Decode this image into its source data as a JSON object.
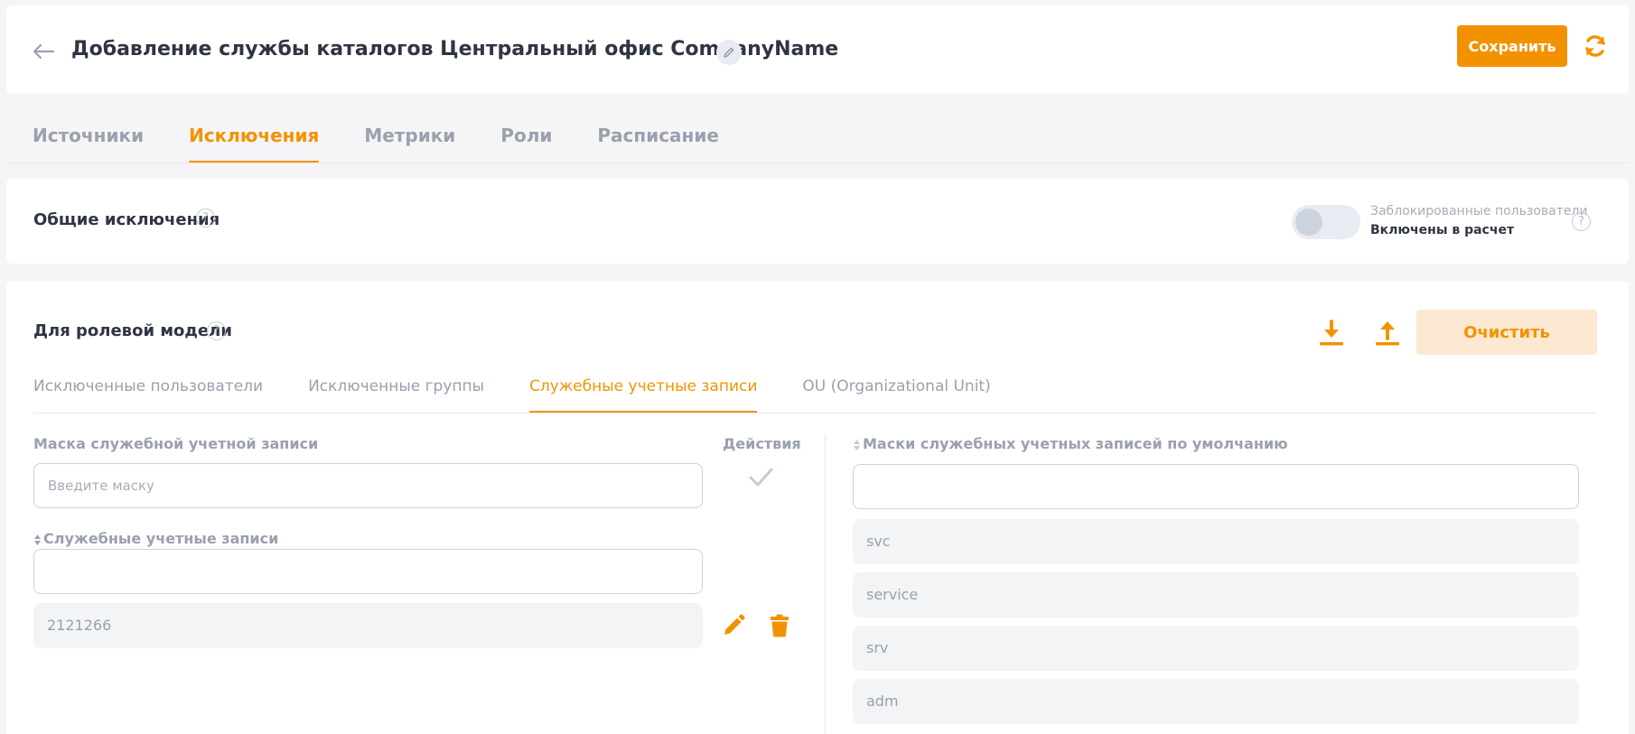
{
  "header": {
    "title": "Добавление службы каталогов Центральный офис CompanyName",
    "save_label": "Сохранить"
  },
  "main_tabs": [
    {
      "label": "Источники",
      "active": false
    },
    {
      "label": "Исключения",
      "active": true
    },
    {
      "label": "Метрики",
      "active": false
    },
    {
      "label": "Роли",
      "active": false
    },
    {
      "label": "Расписание",
      "active": false
    }
  ],
  "general": {
    "title": "Общие исключения",
    "toggle_enabled": false,
    "toggle_title": "Заблокированные пользователи",
    "toggle_status": "Включены в расчет"
  },
  "role_model": {
    "title": "Для ролевой модели",
    "clear_label": "Очистить",
    "tabs": [
      {
        "label": "Исключенные пользователи",
        "active": false
      },
      {
        "label": "Исключенные группы",
        "active": false
      },
      {
        "label": "Служебные учетные записи",
        "active": true
      },
      {
        "label": "OU (Organizational Unit)",
        "active": false
      }
    ],
    "mask_label": "Маска служебной учетной записи",
    "mask_placeholder": "Введите маску",
    "mask_value": "",
    "actions_label": "Действия",
    "accounts_label": "Служебные учетные записи",
    "accounts_filter_value": "",
    "accounts": [
      "2121266"
    ],
    "defaults_label": "Маски служебных учетных записей по умолчанию",
    "defaults_filter_value": "",
    "defaults": [
      "svc",
      "service",
      "srv",
      "adm"
    ]
  },
  "colors": {
    "accent": "#f39200",
    "accent_light": "#fde9d1",
    "background": "#f5f5f7"
  },
  "icons": [
    "arrow-left-icon",
    "pencil-icon",
    "refresh-icon",
    "help-icon",
    "download-icon",
    "upload-icon",
    "check-icon",
    "sort-icon",
    "edit-icon",
    "trash-icon"
  ]
}
